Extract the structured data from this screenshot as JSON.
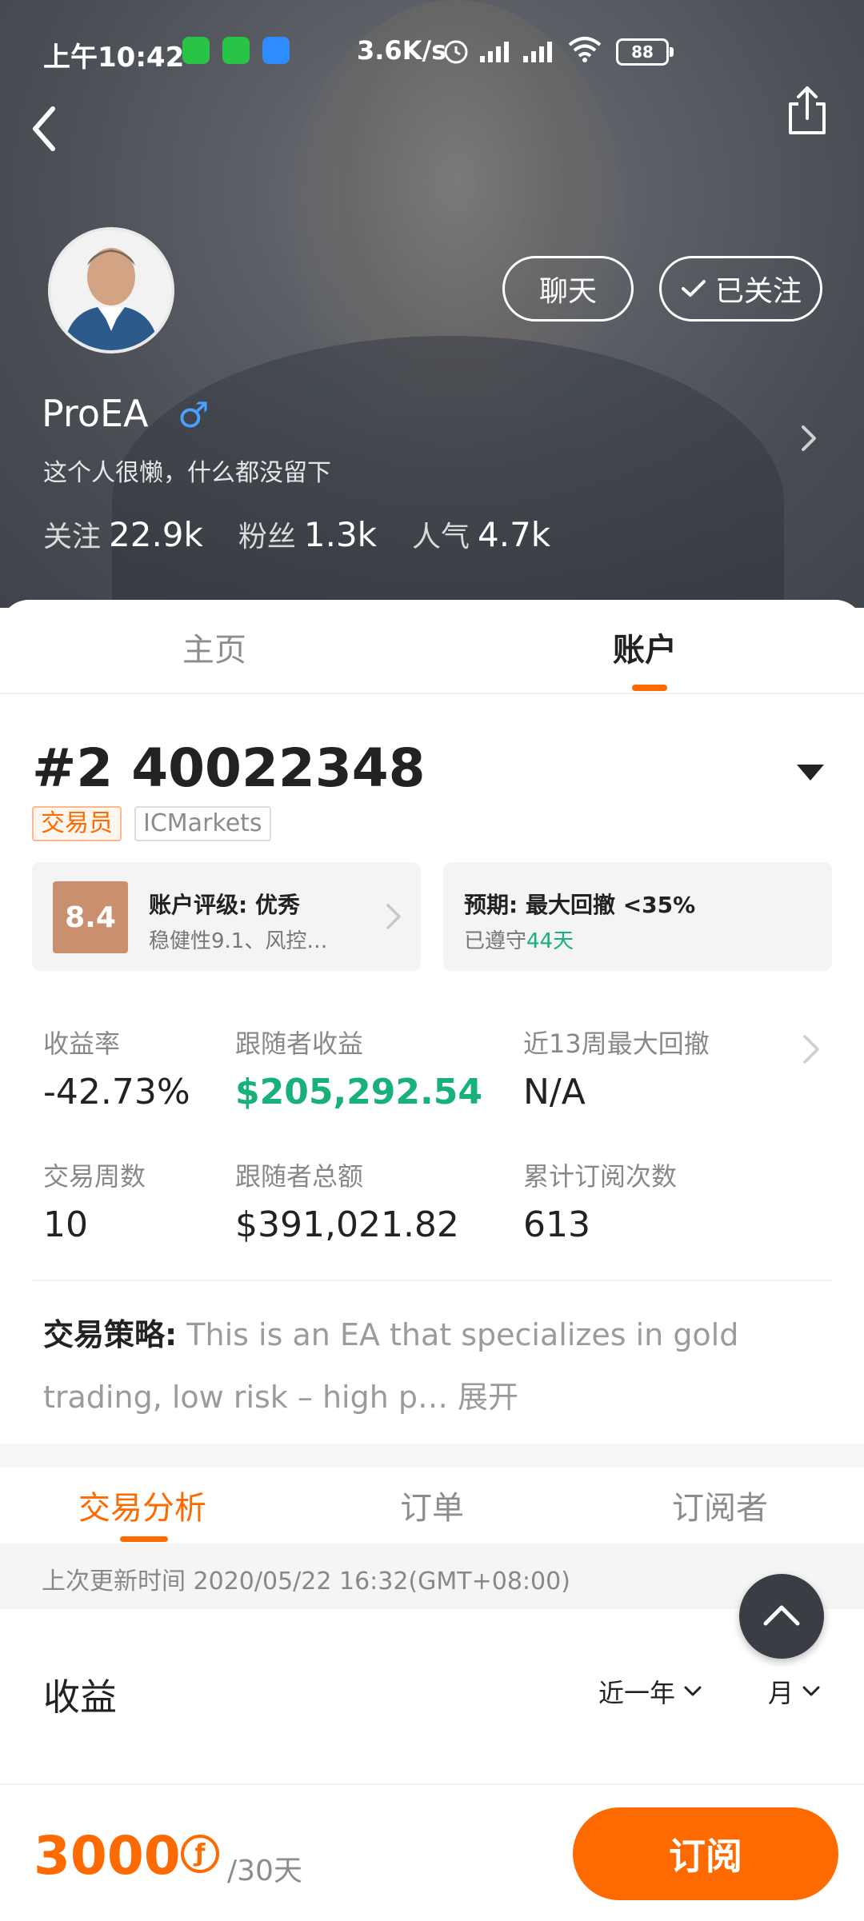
{
  "status_bar": {
    "time": "上午10:42",
    "network_speed": "3.6K/s",
    "battery": "88"
  },
  "profile": {
    "name": "ProEA",
    "gender_symbol": "♂",
    "bio": "这个人很懒，什么都没留下",
    "follow_btn": "聊天",
    "followed_btn": "已关注",
    "stats": [
      {
        "label": "关注",
        "value": "22.9k"
      },
      {
        "label": "粉丝",
        "value": "1.3k"
      },
      {
        "label": "人气",
        "value": "4.7k"
      }
    ]
  },
  "tabs": {
    "home": "主页",
    "account": "账户"
  },
  "account": {
    "title": "#2 40022348",
    "tag_role": "交易员",
    "tag_broker": "ICMarkets",
    "rating_score": "8.4",
    "rating_title": "账户评级: 优秀",
    "rating_sub": "稳健性9.1、风控…",
    "expect_title": "预期: 最大回撤 <35%",
    "expect_sub_prefix": "已遵守",
    "expect_sub_days": "44天"
  },
  "metrics": [
    {
      "label": "收益率",
      "value": "-42.73%"
    },
    {
      "label": "跟随者收益",
      "value": "$205,292.54"
    },
    {
      "label": "近13周最大回撤",
      "value": "N/A"
    },
    {
      "label": "交易周数",
      "value": "10"
    },
    {
      "label": "跟随者总额",
      "value": "$391,021.82"
    },
    {
      "label": "累计订阅次数",
      "value": "613"
    }
  ],
  "strategy": {
    "key": "交易策略:",
    "text": "This is an EA that specializes in gold trading, low risk – high p…",
    "expand": "展开"
  },
  "sub_tabs": [
    "交易分析",
    "订单",
    "订阅者"
  ],
  "last_update": "上次更新时间 2020/05/22 16:32(GMT+08:00)",
  "revenue": {
    "title": "收益",
    "period": "近一年",
    "granularity": "月"
  },
  "bottom": {
    "price": "3000",
    "coin_symbol": "ƒ",
    "per": "/30天",
    "subscribe": "订阅"
  },
  "colors": {
    "accent": "#ff6a00",
    "positive": "#19b17a",
    "score_bg": "#c98f6f"
  }
}
